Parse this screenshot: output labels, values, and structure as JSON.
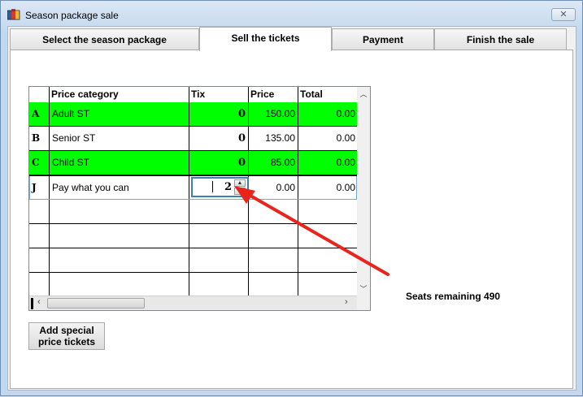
{
  "window": {
    "title": "Season package sale",
    "close_glyph": "✕"
  },
  "tabs": [
    {
      "label": "Select the season package",
      "active": false
    },
    {
      "label": "Sell the tickets",
      "active": true
    },
    {
      "label": "Payment",
      "active": false
    },
    {
      "label": "Finish the sale",
      "active": false
    }
  ],
  "grid": {
    "columns": [
      "",
      "Price category",
      "Tix",
      "Price",
      "Total"
    ],
    "rows": [
      {
        "key": "A",
        "category": "Adult ST",
        "tix": "0",
        "price": "150.00",
        "total": "0.00",
        "highlight": "#00ff00"
      },
      {
        "key": "B",
        "category": "Senior ST",
        "tix": "0",
        "price": "135.00",
        "total": "0.00",
        "highlight": null
      },
      {
        "key": "C",
        "category": "Child ST",
        "tix": "0",
        "price": "85.00",
        "total": "0.00",
        "highlight": "#00ff00"
      },
      {
        "key": "J",
        "category": "Pay what you can",
        "tix": "2",
        "price": "0.00",
        "total": "0.00",
        "highlight": null,
        "editing": true
      }
    ],
    "empty_rows": 4
  },
  "add_special_button": {
    "line1": "Add special",
    "line2": "price tickets"
  },
  "seats_remaining": "Seats remaining 490",
  "annotation": {
    "arrow_color": "#e8241b"
  }
}
